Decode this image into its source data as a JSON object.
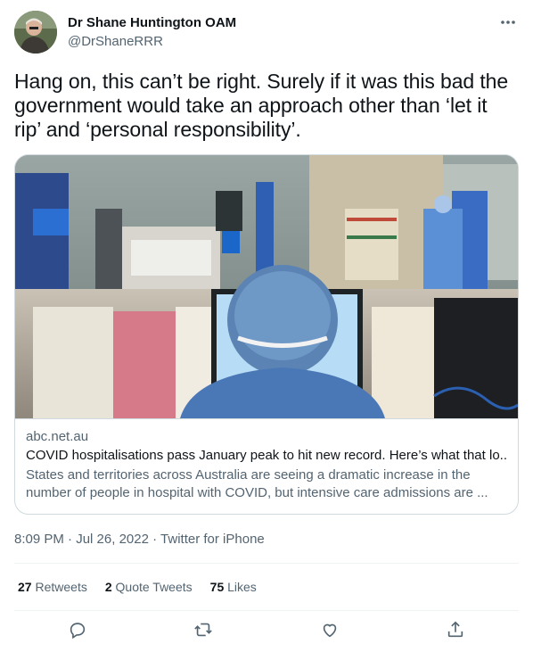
{
  "author": {
    "name": "Dr Shane Huntington OAM",
    "handle": "@DrShaneRRR",
    "avatar_icon": "avatar-photo"
  },
  "tweet": {
    "text": "Hang on, this can’t be right. Surely if it was this bad the government would take an approach other than ‘let it rip’ and ‘personal responsibility’."
  },
  "card": {
    "image_icon": "hospital-icu-photo",
    "domain": "abc.net.au",
    "title": "COVID hospitalisations pass January peak to hit new record. Here’s what that lo...",
    "description": "States and territories across Australia are seeing a dramatic increase in the number of people in hospital with COVID, but intensive care admissions are ..."
  },
  "meta": {
    "time": "8:09 PM",
    "separator": "·",
    "date": "Jul 26, 2022",
    "source": "Twitter for iPhone"
  },
  "stats": {
    "retweets_count": "27",
    "retweets_label": "Retweets",
    "quotes_count": "2",
    "quotes_label": "Quote Tweets",
    "likes_count": "75",
    "likes_label": "Likes"
  },
  "actions": {
    "reply_icon": "reply-icon",
    "retweet_icon": "retweet-icon",
    "like_icon": "like-icon",
    "share_icon": "share-icon"
  },
  "colors": {
    "text": "#0f1419",
    "secondary": "#536471",
    "border": "#cfd9de"
  }
}
